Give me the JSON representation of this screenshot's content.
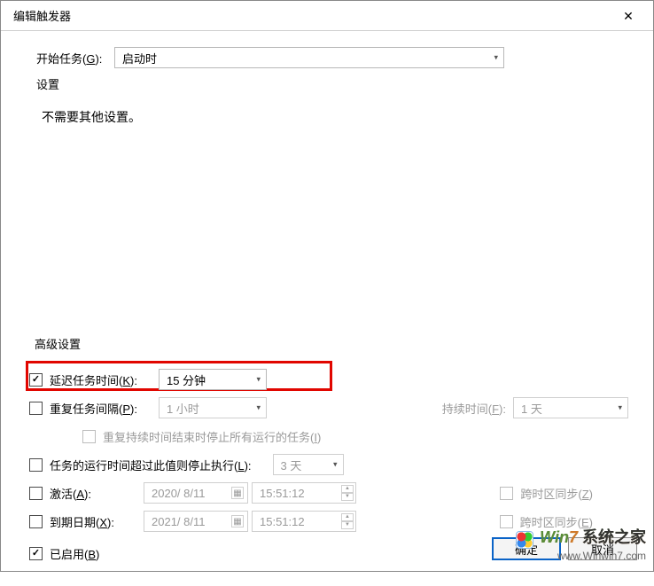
{
  "window": {
    "title": "编辑触发器"
  },
  "start_task": {
    "label_prefix": "开始任务(",
    "label_key": "G",
    "label_suffix": "):",
    "value": "启动时"
  },
  "settings_group": {
    "label": "设置",
    "message": "不需要其他设置。"
  },
  "adv_group": {
    "label": "高级设置"
  },
  "delay": {
    "label_prefix": "延迟任务时间(",
    "label_key": "K",
    "label_suffix": "):",
    "checked": true,
    "value": "15 分钟"
  },
  "repeat": {
    "label_prefix": "重复任务间隔(",
    "label_key": "P",
    "label_suffix": "):",
    "checked": false,
    "value": "1 小时",
    "duration_label_prefix": "持续时间(",
    "duration_label_key": "F",
    "duration_label_suffix": "):",
    "duration_value": "1 天",
    "stop_prefix": "重复持续时间结束时停止所有运行的任务(",
    "stop_key": "I",
    "stop_suffix": ")"
  },
  "stop_after": {
    "label_prefix": "任务的运行时间超过此值则停止执行(",
    "label_key": "L",
    "label_suffix": "):",
    "checked": false,
    "value": "3 天"
  },
  "activate": {
    "label_prefix": "激活(",
    "label_key": "A",
    "label_suffix": "):",
    "checked": false,
    "date": "2020/ 8/11",
    "time": "15:51:12",
    "sync_prefix": "跨时区同步(",
    "sync_key": "Z",
    "sync_suffix": ")"
  },
  "expire": {
    "label_prefix": "到期日期(",
    "label_key": "X",
    "label_suffix": "):",
    "checked": false,
    "date": "2021/ 8/11",
    "time": "15:51:12",
    "sync_prefix": "跨时区同步(",
    "sync_key": "E",
    "sync_suffix": ")"
  },
  "enabled": {
    "label_prefix": "已启用(",
    "label_key": "B",
    "label_suffix": ")",
    "checked": true
  },
  "buttons": {
    "ok": "确定",
    "cancel": "取消"
  },
  "watermark": {
    "brand_left": "Win",
    "brand_right": "7",
    "brand_tail": "系统之家",
    "url": "www.Winwin7.com"
  }
}
